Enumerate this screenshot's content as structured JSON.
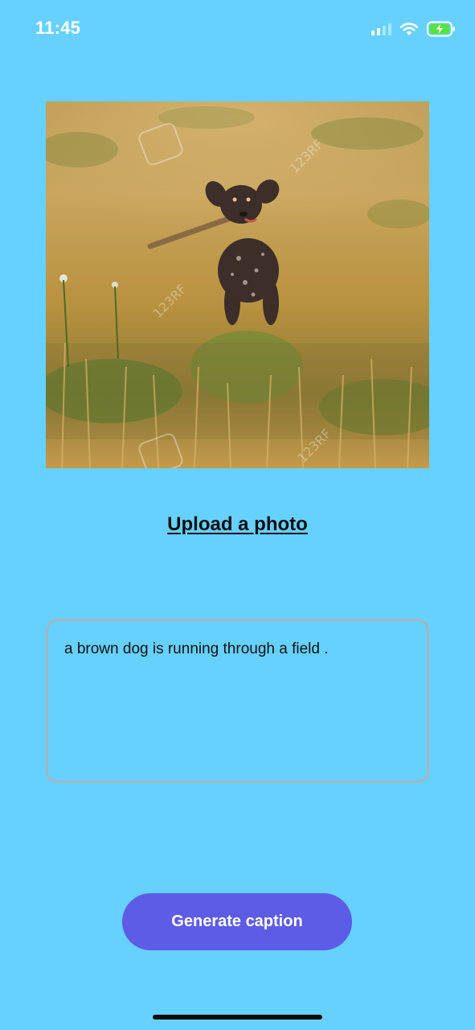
{
  "status_bar": {
    "time": "11:45"
  },
  "photo": {
    "subject": "dog-in-field"
  },
  "upload": {
    "label": "Upload a photo"
  },
  "caption": {
    "text": "a brown dog is running through a field ."
  },
  "generate_button": {
    "label": "Generate caption"
  },
  "colors": {
    "background": "#66D1FF",
    "button": "#5C5CE6",
    "battery_charge": "#57E33F",
    "caption_border": "#A4B6BF"
  },
  "icons": [
    "signal-icon",
    "wifi-icon",
    "battery-charging-icon"
  ]
}
